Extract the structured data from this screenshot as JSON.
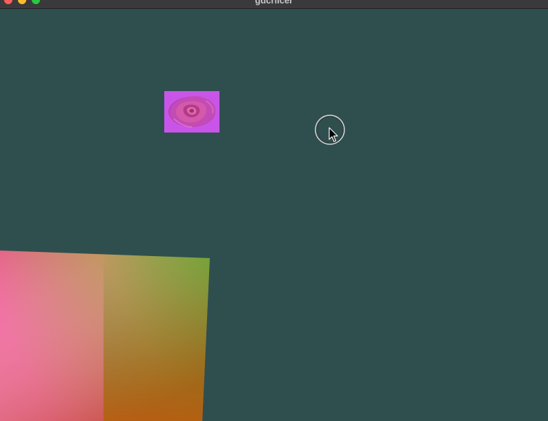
{
  "window": {
    "title": "gdcriicer"
  },
  "titlebar": {
    "buttons": [
      {
        "name": "close",
        "color": "#ff5f57"
      },
      {
        "name": "minimize",
        "color": "#febc2e"
      },
      {
        "name": "maximize",
        "color": "#28c840"
      }
    ]
  },
  "canvas": {
    "background": "#2f4f4f",
    "sprite": {
      "icon": "rose-sprite",
      "background": "#c955e8"
    },
    "gradient_quad": {
      "colors": [
        "#f25a9c",
        "#3aa000",
        "#d5534e",
        "#b3610a"
      ]
    },
    "cursor": {
      "icon": "arrow-cursor-with-ring"
    }
  }
}
